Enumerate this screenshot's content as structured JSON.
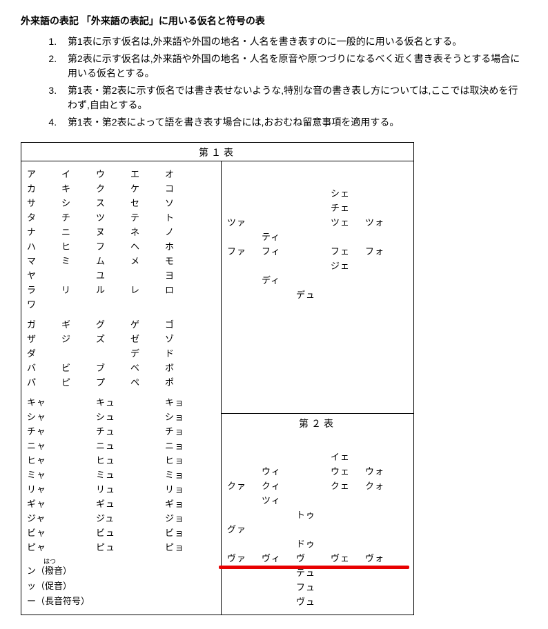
{
  "title": "外来語の表記 「外来語の表記」に用いる仮名と符号の表",
  "notes": [
    "第1表に示す仮名は,外来語や外国の地名・人名を書き表すのに一般的に用いる仮名とする。",
    "第2表に示す仮名は,外来語や外国の地名・人名を原音や原つづりになるべく近く書き表そうとする場合に用いる仮名とする。",
    "第1表・第2表に示す仮名では書き表せないような,特別な音の書き表し方については,ここでは取決めを行わず,自由とする。",
    "第1表・第2表によって語を書き表す場合には,おおむね留意事項を適用する。"
  ],
  "table1Header": "第１表",
  "table2Header": "第２表",
  "gojuon": [
    [
      "ア",
      "イ",
      "ウ",
      "エ",
      "オ"
    ],
    [
      "カ",
      "キ",
      "ク",
      "ケ",
      "コ"
    ],
    [
      "サ",
      "シ",
      "ス",
      "セ",
      "ソ"
    ],
    [
      "タ",
      "チ",
      "ツ",
      "テ",
      "ト"
    ],
    [
      "ナ",
      "ニ",
      "ヌ",
      "ネ",
      "ノ"
    ],
    [
      "ハ",
      "ヒ",
      "フ",
      "ヘ",
      "ホ"
    ],
    [
      "マ",
      "ミ",
      "ム",
      "メ",
      "モ"
    ],
    [
      "ヤ",
      "",
      "ユ",
      "",
      "ヨ"
    ],
    [
      "ラ",
      "リ",
      "ル",
      "レ",
      "ロ"
    ],
    [
      "ワ",
      "",
      "",
      "",
      ""
    ]
  ],
  "daku": [
    [
      "ガ",
      "ギ",
      "グ",
      "ゲ",
      "ゴ"
    ],
    [
      "ザ",
      "ジ",
      "ズ",
      "ゼ",
      "ゾ"
    ],
    [
      "ダ",
      "",
      "",
      "デ",
      "ド"
    ],
    [
      "バ",
      "ビ",
      "ブ",
      "ベ",
      "ボ"
    ],
    [
      "パ",
      "ピ",
      "プ",
      "ペ",
      "ポ"
    ]
  ],
  "yoon": [
    [
      "キャ",
      "",
      "キュ",
      "",
      "キョ"
    ],
    [
      "シャ",
      "",
      "シュ",
      "",
      "ショ"
    ],
    [
      "チャ",
      "",
      "チュ",
      "",
      "チョ"
    ],
    [
      "ニャ",
      "",
      "ニュ",
      "",
      "ニョ"
    ],
    [
      "ヒャ",
      "",
      "ヒュ",
      "",
      "ヒョ"
    ],
    [
      "ミャ",
      "",
      "ミュ",
      "",
      "ミョ"
    ],
    [
      "リャ",
      "",
      "リュ",
      "",
      "リョ"
    ],
    [
      "ギャ",
      "",
      "ギュ",
      "",
      "ギョ"
    ],
    [
      "ジャ",
      "",
      "ジュ",
      "",
      "ジョ"
    ],
    [
      "ビャ",
      "",
      "ビュ",
      "",
      "ビョ"
    ],
    [
      "ピャ",
      "",
      "ピュ",
      "",
      "ピョ"
    ]
  ],
  "extras": {
    "ruby": "はつ",
    "line1": "ン（撥音）",
    "line2": "ッ（促音）",
    "line3": "ー（長音符号）"
  },
  "t1extra": [
    [
      "",
      "",
      "",
      "シェ",
      ""
    ],
    [
      "",
      "",
      "",
      "チェ",
      ""
    ],
    [
      "ツァ",
      "",
      "",
      "ツェ",
      "ツォ"
    ],
    [
      "",
      "ティ",
      "",
      "",
      ""
    ],
    [
      "ファ",
      "フィ",
      "",
      "フェ",
      "フォ"
    ],
    [
      "",
      "",
      "",
      "ジェ",
      ""
    ],
    [
      "",
      "ディ",
      "",
      "",
      ""
    ],
    [
      "",
      "",
      "デュ",
      "",
      ""
    ]
  ],
  "t2extra": [
    [
      "",
      "",
      "",
      "イェ",
      ""
    ],
    [
      "",
      "ウィ",
      "",
      "ウェ",
      "ウォ"
    ],
    [
      "クァ",
      "クィ",
      "",
      "クェ",
      "クォ"
    ],
    [
      "",
      "ツィ",
      "",
      "",
      ""
    ],
    [
      "",
      "",
      "トゥ",
      "",
      ""
    ],
    [
      "グァ",
      "",
      "",
      "",
      ""
    ],
    [
      "",
      "",
      "ドゥ",
      "",
      ""
    ],
    [
      "ヴァ",
      "ヴィ",
      "ヴ",
      "ヴェ",
      "ヴォ"
    ],
    [
      "",
      "",
      "テュ",
      "",
      ""
    ],
    [
      "",
      "",
      "フュ",
      "",
      ""
    ],
    [
      "",
      "",
      "ヴュ",
      "",
      ""
    ]
  ]
}
